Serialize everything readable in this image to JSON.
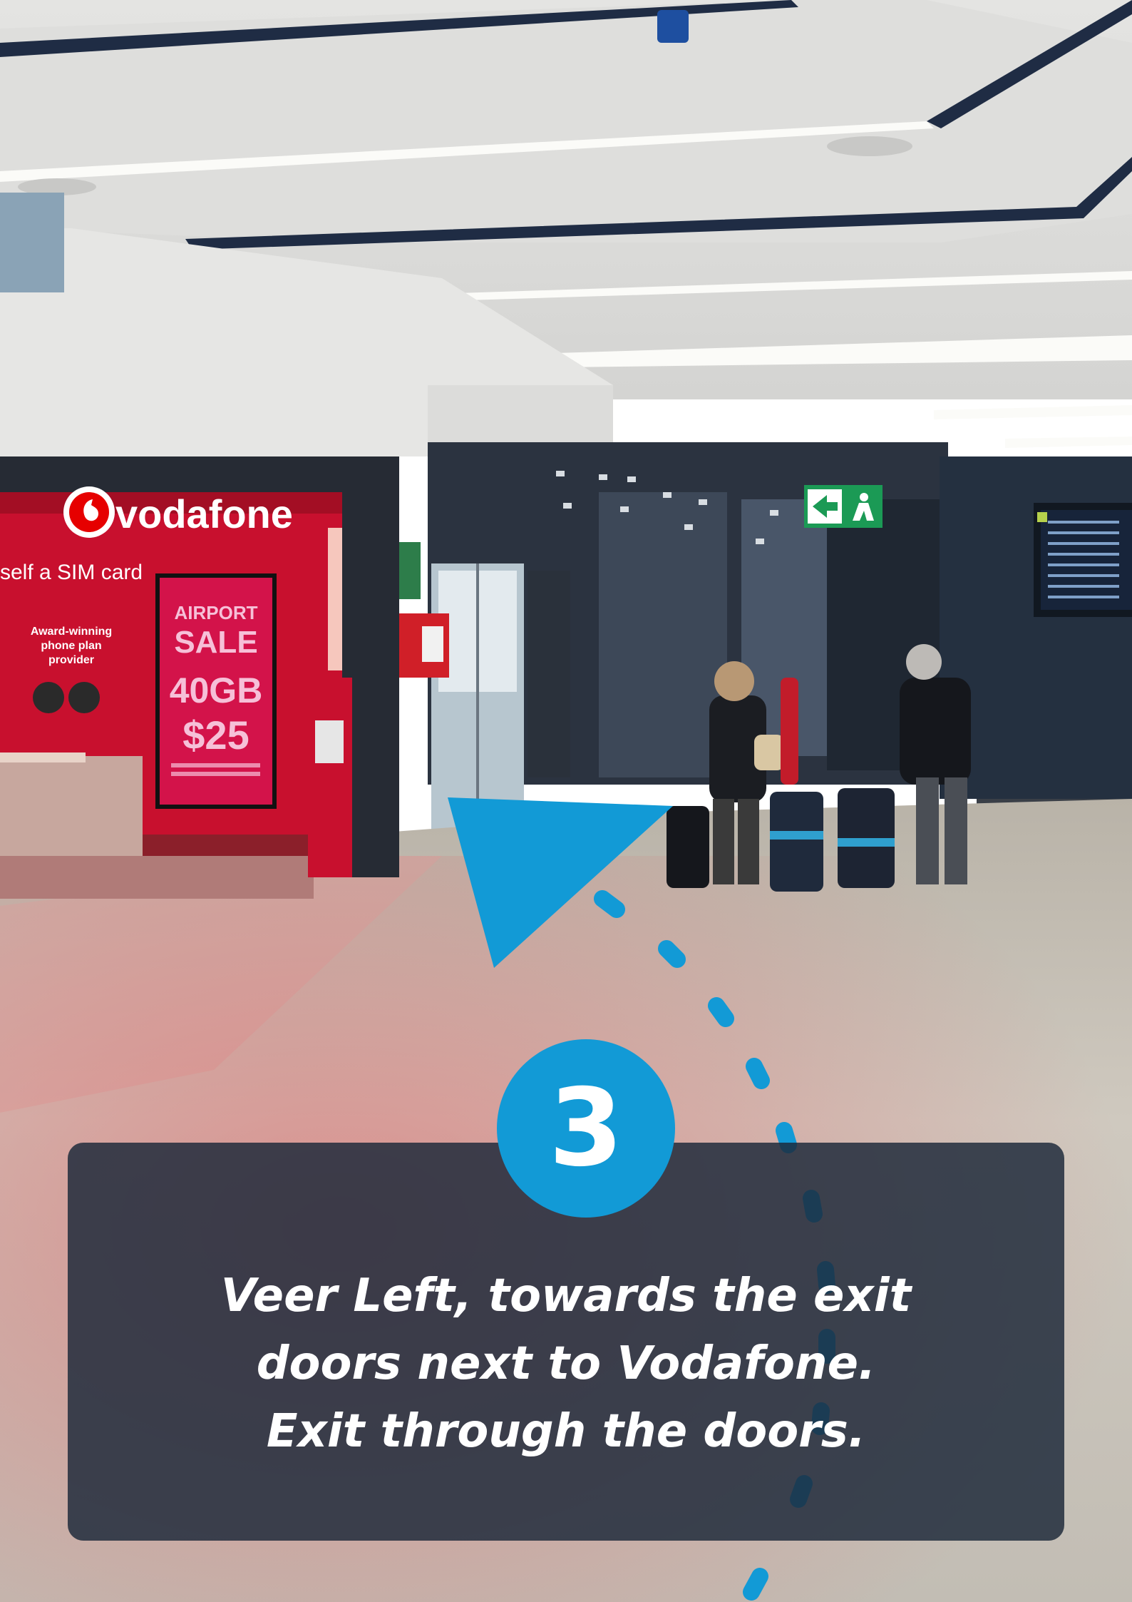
{
  "store": {
    "brand": "vodafone",
    "banner": "self a SIM card",
    "promo_lines": [
      "Award-winning",
      "phone plan",
      "provider"
    ],
    "poster": {
      "headline": "AIRPORT",
      "sale": "SALE",
      "data": "40GB",
      "price": "$25"
    }
  },
  "step": {
    "number": "3",
    "lines": [
      "Veer Left, towards the exit",
      "doors next to Vodafone.",
      "Exit through the doors."
    ]
  },
  "colors": {
    "accent": "#129ad6",
    "panel": "#1e2a3a",
    "vodafone_red": "#d7192b",
    "exit_sign": "#1b9a55"
  }
}
